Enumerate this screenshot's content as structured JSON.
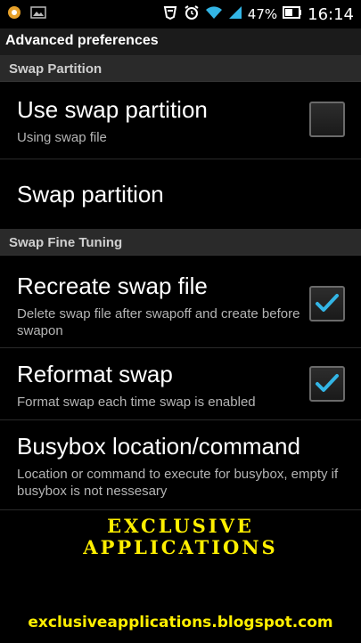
{
  "status_bar": {
    "battery": "47%",
    "time": "16:14",
    "icons": [
      "notification-app-icon",
      "gallery-icon",
      "bug-icon",
      "alarm-icon",
      "wifi-icon",
      "signal-icon",
      "battery-icon"
    ]
  },
  "title_bar": {
    "title": "Advanced preferences"
  },
  "sections": [
    {
      "header": "Swap Partition",
      "items": [
        {
          "title": "Use swap partition",
          "summary": "Using swap file",
          "checked": false
        },
        {
          "title": "Swap partition",
          "summary": ""
        }
      ]
    },
    {
      "header": "Swap Fine Tuning",
      "items": [
        {
          "title": "Recreate swap file",
          "summary": "Delete swap file after swapoff and create before swapon",
          "checked": true
        },
        {
          "title": "Reformat swap",
          "summary": "Format swap each time swap is enabled",
          "checked": true
        },
        {
          "title": "Busybox location/command",
          "summary": "Location or command to execute for busybox, empty if busybox is not nessesary"
        }
      ]
    }
  ],
  "watermark": {
    "line1": "EXCLUSIVE",
    "line2": "APPLICATIONS",
    "blog": "exclusiveapplications.blogspot.com"
  },
  "colors": {
    "accent_check": "#33b5e5",
    "watermark": "#ffef00"
  }
}
